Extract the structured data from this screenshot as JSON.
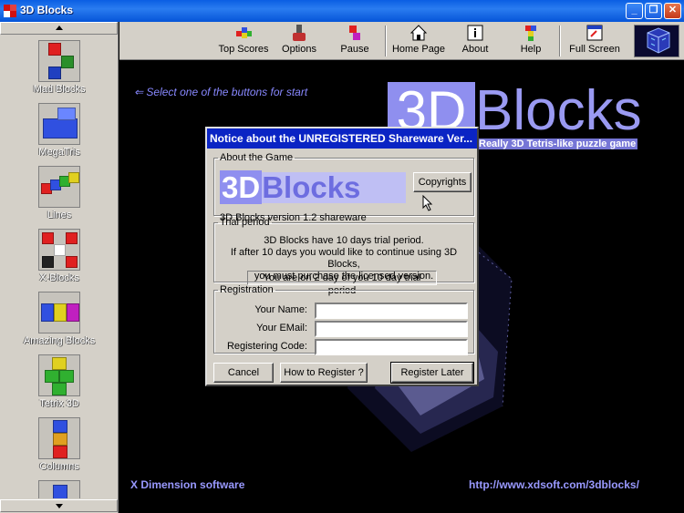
{
  "window": {
    "title": "3D Blocks"
  },
  "toolbar": {
    "top_scores": "Top Scores",
    "options": "Options",
    "pause": "Pause",
    "home_page": "Home Page",
    "about": "About",
    "help": "Help",
    "full_screen": "Full Screen"
  },
  "sidebar": {
    "items": [
      {
        "label": "Mad Blocks"
      },
      {
        "label": "MegaTris"
      },
      {
        "label": "Lines"
      },
      {
        "label": "X-Blocks"
      },
      {
        "label": "Amazing Blocks"
      },
      {
        "label": "Tetrix 3D"
      },
      {
        "label": "Columns"
      }
    ]
  },
  "main": {
    "hint": "Select one of the buttons for start",
    "logo_3d": "3D",
    "logo_blocks": "Blocks",
    "tagline": "Really 3D Tetris-like puzzle game",
    "company": "X Dimension software",
    "url": "http://www.xdsoft.com/3dblocks/"
  },
  "dialog": {
    "title": "Notice about the UNREGISTERED Shareware Ver...",
    "about_legend": "About the Game",
    "logo_3d": "3D",
    "logo_blocks": "Blocks",
    "copyrights_button": "Copyrights",
    "version": "3D Blocks version 1.2 shareware",
    "trial_legend": "Trial period",
    "trial_line1": "3D Blocks have 10 days trial period.",
    "trial_line2": "If after 10 days you would like to continue using 3D Blocks,",
    "trial_line3": "you must purchase the licensed version.",
    "trial_status": "You are on 2 day of you 10 day trial period",
    "registration_legend": "Registration",
    "name_label": "Your Name:",
    "email_label": "Your EMail:",
    "code_label": "Registering Code:",
    "name_value": "",
    "email_value": "",
    "code_value": "",
    "cancel_button": "Cancel",
    "how_button": "How to Register ?",
    "later_button": "Register Later"
  },
  "colors": {
    "titlebar": "#0a5ee3",
    "dialog_title": "#0a24c4",
    "logo_blue": "#8f8fef",
    "footer_text": "#9999ff"
  }
}
